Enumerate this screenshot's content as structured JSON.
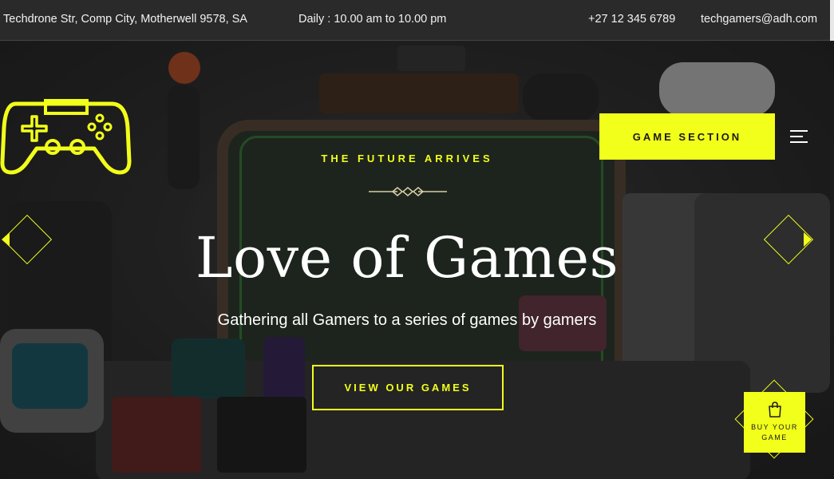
{
  "topbar": {
    "address": "Techdrone Str, Comp City, Motherwell 9578, SA",
    "hours": "Daily : 10.00 am to 10.00 pm",
    "phone": "+27 12 345 6789",
    "email": "techgamers@adh.com"
  },
  "nav": {
    "game_section_label": "GAME SECTION",
    "menu_icon": "hamburger-menu-icon"
  },
  "logo": {
    "icon": "gamepad-icon"
  },
  "hero": {
    "subtitle": "THE FUTURE ARRIVES",
    "headline": "Love of Games",
    "tagline": "Gathering all Gamers to a series of games by gamers",
    "cta_label": "VIEW OUR GAMES"
  },
  "slider": {
    "prev_icon": "arrow-left-icon",
    "next_icon": "arrow-right-icon"
  },
  "buy": {
    "icon": "shopping-bag-icon",
    "label": "BUY YOUR GAME"
  },
  "colors": {
    "accent": "#f2ff1a",
    "topbar_bg": "#2a2a2a",
    "text": "#ffffff"
  }
}
